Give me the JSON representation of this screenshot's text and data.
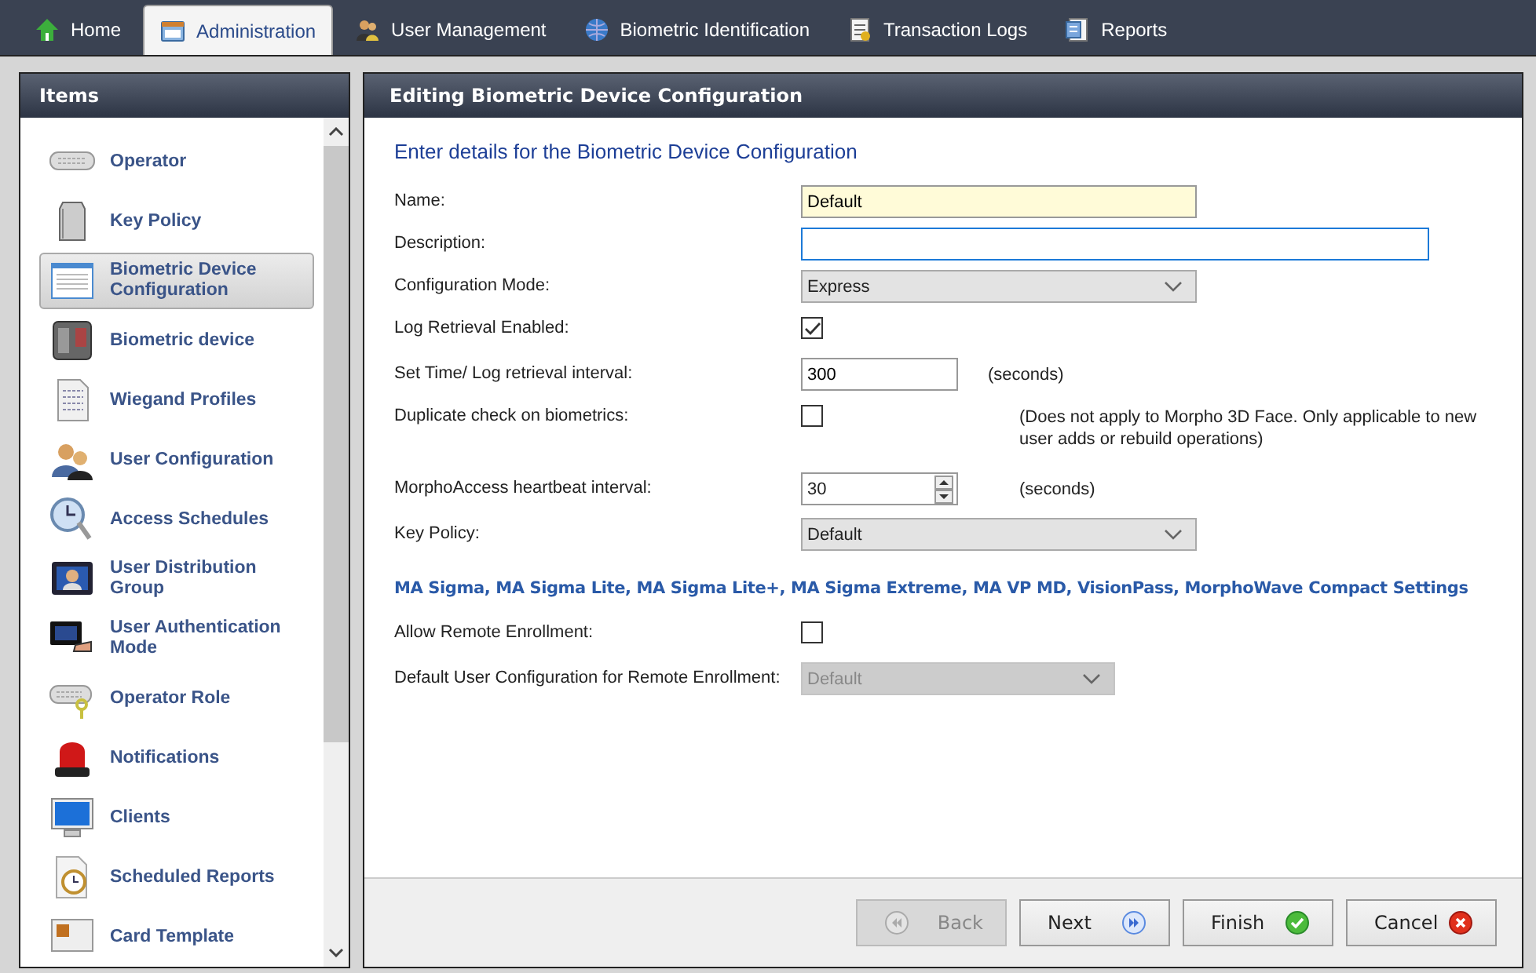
{
  "tabs": [
    {
      "label": "Home",
      "selected": false
    },
    {
      "label": "Administration",
      "selected": true
    },
    {
      "label": "User Management",
      "selected": false
    },
    {
      "label": "Biometric Identification",
      "selected": false
    },
    {
      "label": "Transaction Logs",
      "selected": false
    },
    {
      "label": "Reports",
      "selected": false
    }
  ],
  "sidebar": {
    "title": "Items",
    "items": [
      {
        "label": "Operator",
        "selected": false
      },
      {
        "label": "Key Policy",
        "selected": false
      },
      {
        "label": "Biometric Device Configuration",
        "selected": true
      },
      {
        "label": "Biometric device",
        "selected": false
      },
      {
        "label": "Wiegand Profiles",
        "selected": false
      },
      {
        "label": "User Configuration",
        "selected": false
      },
      {
        "label": "Access Schedules",
        "selected": false
      },
      {
        "label": "User Distribution Group",
        "selected": false
      },
      {
        "label": "User Authentication Mode",
        "selected": false
      },
      {
        "label": "Operator Role",
        "selected": false
      },
      {
        "label": "Notifications",
        "selected": false
      },
      {
        "label": "Clients",
        "selected": false
      },
      {
        "label": "Scheduled Reports",
        "selected": false
      },
      {
        "label": "Card Template",
        "selected": false
      }
    ]
  },
  "panel": {
    "title": "Editing Biometric Device Configuration",
    "heading": "Enter details for the Biometric Device Configuration",
    "fields": [
      {
        "kind": "text",
        "label": "Name:",
        "value": "Default",
        "highlighted": true,
        "focused": false
      },
      {
        "kind": "text",
        "label": "Description:",
        "highlighted": false,
        "focused": true
      },
      {
        "kind": "select",
        "label": "Configuration Mode:",
        "value": "Express",
        "disabled": false
      },
      {
        "kind": "checkbox",
        "label": "Log Retrieval Enabled:",
        "checked": true
      },
      {
        "kind": "text",
        "label": "Set Time/ Log retrieval interval:",
        "value": "300",
        "highlighted": false,
        "focused": false,
        "note": "(seconds)"
      },
      {
        "kind": "checkbox",
        "label": "Duplicate check on biometrics:",
        "checked": false,
        "note": "(Does not apply to Morpho 3D Face. Only applicable to new user adds or rebuild operations)"
      },
      {
        "kind": "spinner",
        "label": "MorphoAccess heartbeat interval:",
        "value": "30",
        "note": "(seconds)"
      },
      {
        "kind": "select",
        "label": "Key Policy:",
        "value": "Default",
        "disabled": false
      }
    ],
    "section_title": "MA Sigma, MA Sigma Lite, MA Sigma Lite+, MA Sigma Extreme, MA VP MD, VisionPass, MorphoWave Compact Settings",
    "section_fields": [
      {
        "kind": "checkbox",
        "label": "Allow Remote Enrollment:",
        "checked": false
      },
      {
        "kind": "select",
        "label": "Default User Configuration for Remote Enrollment:",
        "value": "Default",
        "disabled": true
      }
    ]
  },
  "buttons": [
    {
      "label": "Back",
      "kind": "back",
      "disabled": true
    },
    {
      "label": "Next",
      "kind": "next",
      "disabled": false
    },
    {
      "label": "Finish",
      "kind": "finish",
      "disabled": false
    },
    {
      "label": "Cancel",
      "kind": "cancel",
      "disabled": false
    }
  ]
}
